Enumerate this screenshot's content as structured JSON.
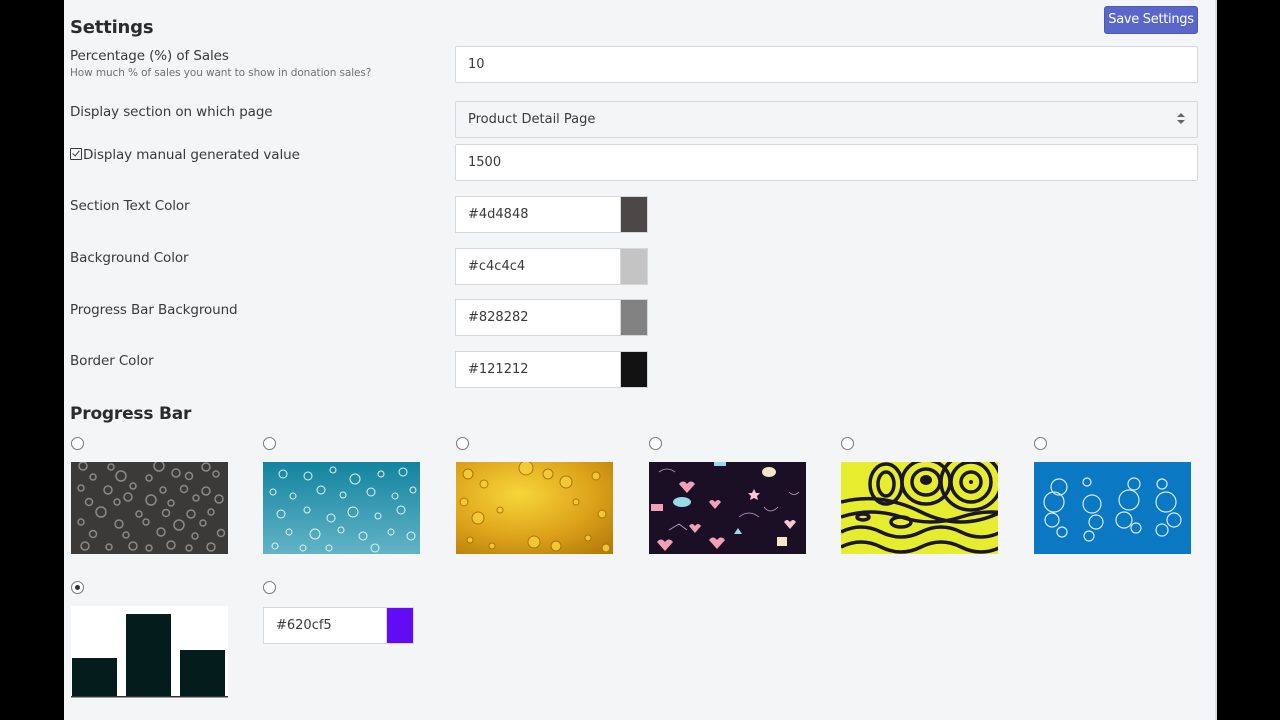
{
  "header": {
    "title": "Settings",
    "save_label": "Save Settings"
  },
  "form": {
    "percentage": {
      "label": "Percentage (%) of Sales",
      "hint": "How much % of sales you want to show in donation sales?",
      "value": "10"
    },
    "display_page": {
      "label": "Display section on which page",
      "selected": "Product Detail Page"
    },
    "manual_value": {
      "label": "Display manual generated value",
      "checked": true,
      "value": "1500"
    },
    "colors": [
      {
        "label": "Section Text Color",
        "value": "#4d4848"
      },
      {
        "label": "Background Color",
        "value": "#c4c4c4"
      },
      {
        "label": "Progress Bar Background",
        "value": "#828282"
      },
      {
        "label": "Border Color",
        "value": "#121212"
      }
    ]
  },
  "progress_bar": {
    "title": "Progress Bar",
    "options": [
      {
        "name": "dark-bubbles",
        "selected": false
      },
      {
        "name": "blue-bubbles",
        "selected": false
      },
      {
        "name": "golden-bubbles",
        "selected": false
      },
      {
        "name": "doodle-hearts",
        "selected": false
      },
      {
        "name": "yellow-black-waves",
        "selected": false
      },
      {
        "name": "blue-bubble-clusters",
        "selected": false
      },
      {
        "name": "bar-chart-solid",
        "selected": true
      },
      {
        "name": "custom-color",
        "selected": false
      }
    ],
    "custom_color": "#620cf5"
  }
}
